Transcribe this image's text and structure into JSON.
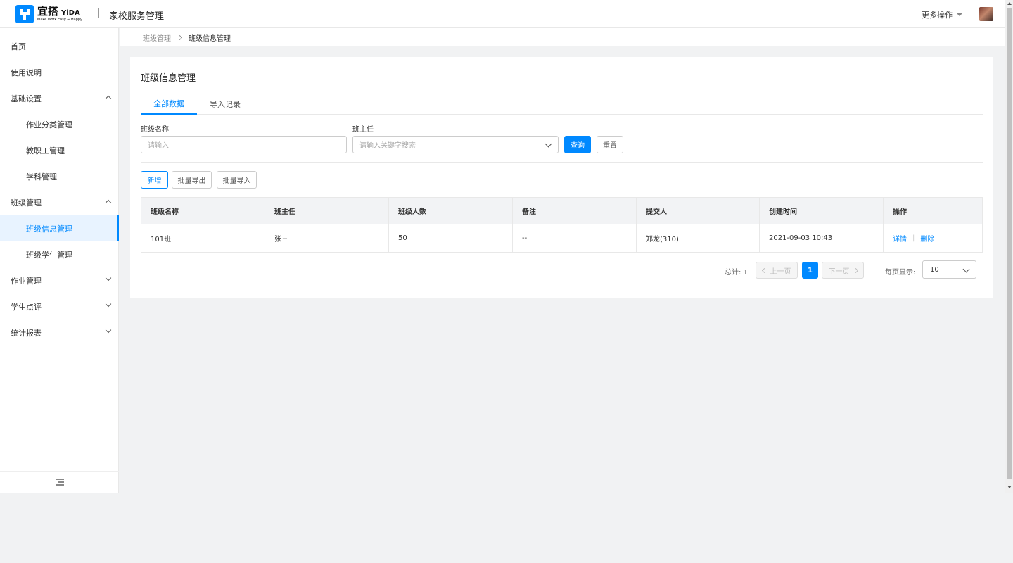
{
  "header": {
    "logo_cn": "宜搭",
    "logo_en": "YiDA",
    "logo_tagline": "Make Work Easy & Happy",
    "app_title": "家校服务管理",
    "more_ops": "更多操作"
  },
  "sidebar": {
    "items": [
      {
        "label": "首页"
      },
      {
        "label": "使用说明"
      },
      {
        "label": "基础设置"
      },
      {
        "label": "作业分类管理"
      },
      {
        "label": "教职工管理"
      },
      {
        "label": "学科管理"
      },
      {
        "label": "班级管理"
      },
      {
        "label": "班级信息管理"
      },
      {
        "label": "班级学生管理"
      },
      {
        "label": "作业管理"
      },
      {
        "label": "学生点评"
      },
      {
        "label": "统计报表"
      }
    ]
  },
  "breadcrumb": {
    "parent": "班级管理",
    "current": "班级信息管理"
  },
  "page": {
    "title": "班级信息管理",
    "tabs": [
      {
        "label": "全部数据"
      },
      {
        "label": "导入记录"
      }
    ],
    "filters": {
      "class_name_label": "班级名称",
      "class_name_placeholder": "请输入",
      "head_teacher_label": "班主任",
      "head_teacher_placeholder": "请输入关键字搜索",
      "search_button": "查询",
      "reset_button": "重置"
    },
    "actions": {
      "add": "新增",
      "batch_export": "批量导出",
      "batch_import": "批量导入"
    },
    "table": {
      "columns": [
        "班级名称",
        "班主任",
        "班级人数",
        "备注",
        "提交人",
        "创建时间",
        "操作"
      ],
      "rows": [
        {
          "class_name": "101班",
          "head_teacher": "张三",
          "count": "50",
          "note": "--",
          "submitter": "郑龙(310)",
          "created": "2021-09-03 10:43",
          "op_detail": "详情",
          "op_delete": "删除"
        }
      ]
    },
    "pagination": {
      "total": "总计: 1",
      "prev": "上一页",
      "next": "下一页",
      "current_page": "1",
      "page_size_label": "每页显示:",
      "page_size": "10"
    }
  },
  "colors": {
    "primary": "#0089ff",
    "background": "#f1f2f3"
  }
}
